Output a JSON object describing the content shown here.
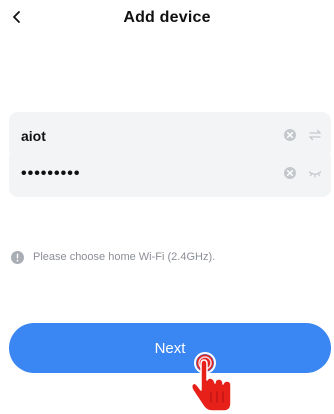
{
  "header": {
    "title": "Add device",
    "back_icon": "chevron-left-icon"
  },
  "wifi": {
    "ssid_value": "aiot",
    "password_value": "•••••••••",
    "clear_icon": "clear-icon",
    "switch_icon": "swap-arrows-icon",
    "visibility_icon": "eye-closed-icon"
  },
  "hint": {
    "icon": "info-icon",
    "text": "Please choose home Wi-Fi (2.4GHz)."
  },
  "actions": {
    "next_label": "Next"
  },
  "overlay": {
    "pointer_icon": "tap-hand-icon"
  },
  "colors": {
    "accent": "#3a86f2",
    "field_bg": "#f3f4f6",
    "icon_gray": "#c4c7cc",
    "hint_text": "#8c8f96",
    "pointer_red": "#e8201a"
  }
}
